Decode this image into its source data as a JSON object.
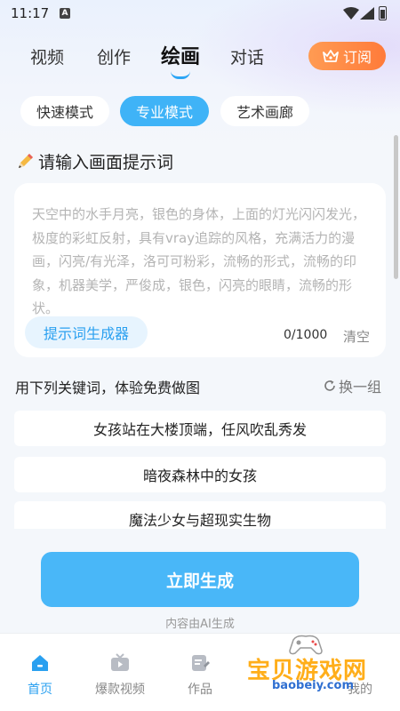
{
  "status_bar": {
    "time": "11:17",
    "notif_letter": "A"
  },
  "top_tabs": [
    {
      "label": "视频",
      "active": false
    },
    {
      "label": "创作",
      "active": false
    },
    {
      "label": "绘画",
      "active": true
    },
    {
      "label": "对话",
      "active": false
    }
  ],
  "subscribe_label": "订阅",
  "modes": [
    {
      "label": "快速模式",
      "active": false
    },
    {
      "label": "专业模式",
      "active": true
    },
    {
      "label": "艺术画廊",
      "active": false
    }
  ],
  "prompt": {
    "title": "请输入画面提示词",
    "placeholder": "天空中的水手月亮，银色的身体，上面的灯光闪闪发光，极度的彩虹反射，具有vray追踪的风格，充满活力的漫画，闪亮/有光泽，洛可可粉彩，流畅的形式，流畅的印象，机器美学，严俊成，银色，闪亮的眼睛，流畅的形状。",
    "generator_label": "提示词生成器",
    "char_count": "0/1000",
    "clear_label": "清空"
  },
  "keywords": {
    "title": "用下列关键词，体验免费做图",
    "refresh_label": "换一组",
    "items": [
      "女孩站在大楼顶端，任风吹乱秀发",
      "暗夜森林中的女孩",
      "魔法少女与超现实生物"
    ]
  },
  "generate_label": "立即生成",
  "ai_note": "内容由AI生成",
  "bottom_nav": [
    {
      "label": "首页",
      "icon": "home-icon",
      "active": true
    },
    {
      "label": "爆款视频",
      "icon": "tv-icon",
      "active": false
    },
    {
      "label": "作品",
      "icon": "works-icon",
      "active": false
    },
    {
      "label": "",
      "icon": "",
      "active": false
    },
    {
      "label": "我的",
      "icon": "profile-icon",
      "active": false
    }
  ],
  "watermark": {
    "text": "宝贝游戏网",
    "url": "baobeiy.com"
  },
  "colors": {
    "accent": "#3fb3f7",
    "subscribe": "#ff8a45",
    "background": "#f4f7fb"
  }
}
